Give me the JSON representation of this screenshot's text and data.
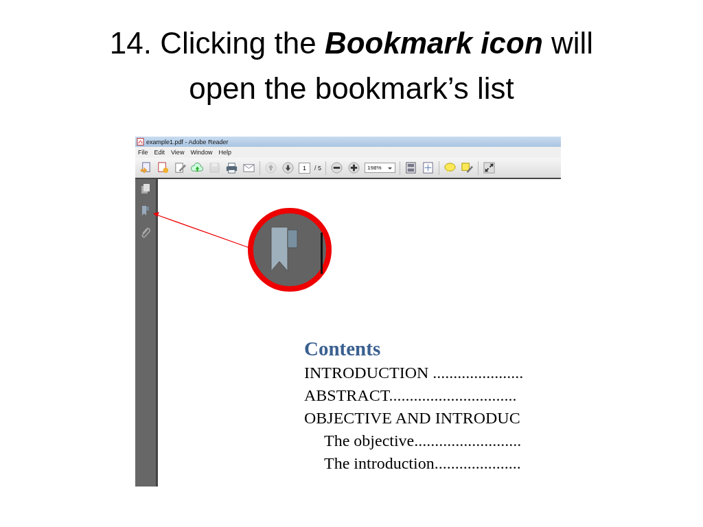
{
  "slide": {
    "title": "14. Clicking the **Bookmark icon** will open the bookmark’s list"
  },
  "window": {
    "title": "example1.pdf - Adobe Reader"
  },
  "menu": [
    "File",
    "Edit",
    "View",
    "Window",
    "Help"
  ],
  "toolbar": {
    "save_button": {
      "disabled": true
    },
    "previous_page_button": {
      "disabled": true
    },
    "page_number": "1",
    "page_count": "/ 5",
    "zoom": "198%"
  },
  "document": {
    "heading": "Contents",
    "toc": [
      {
        "text": "INTRODUCTION ......................"
      },
      {
        "text": "ABSTRACT..............................."
      },
      {
        "text": "OBJECTIVE AND INTRODUC",
        "children": [
          {
            "text": "The objective.........................."
          },
          {
            "text": "The introduction....................."
          }
        ]
      }
    ]
  }
}
